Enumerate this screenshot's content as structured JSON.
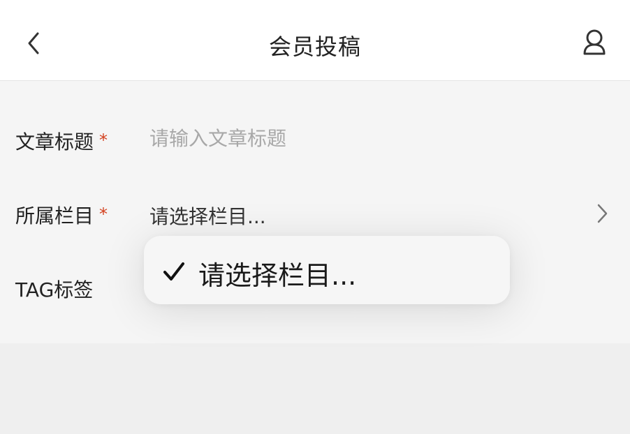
{
  "header": {
    "title": "会员投稿",
    "back_icon": "chevron-left-icon",
    "user_icon": "user-icon"
  },
  "form": {
    "fields": [
      {
        "label": "文章标题",
        "required": true,
        "placeholder": "请输入文章标题",
        "value": ""
      },
      {
        "label": "所属栏目",
        "required": true,
        "value": "请选择栏目...",
        "icon": "chevron-right-icon"
      },
      {
        "label": "TAG标签",
        "required": false,
        "value": ""
      }
    ],
    "required_mark": "*"
  },
  "dropdown": {
    "options": [
      {
        "label": "请选择栏目...",
        "selected": true,
        "icon": "checkmark-icon"
      }
    ]
  },
  "colors": {
    "required": "#d3411f",
    "placeholder": "#a8a8a8",
    "background": "#efefef"
  }
}
